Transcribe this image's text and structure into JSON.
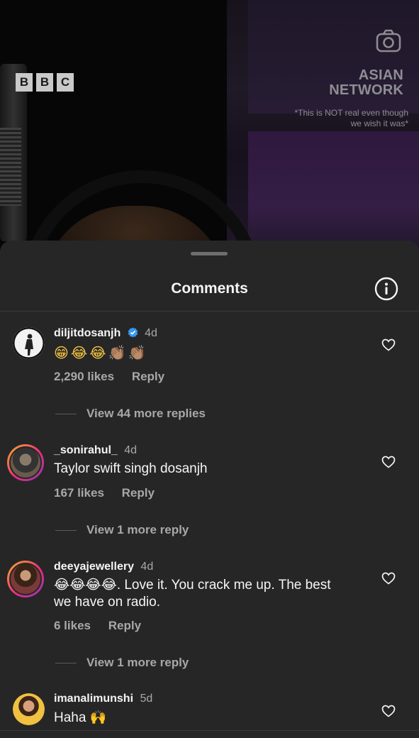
{
  "video": {
    "bbc_letters": [
      "B",
      "B",
      "C"
    ],
    "network_title_line1": "ASIAN",
    "network_title_line2": "NETWORK",
    "network_note": "*This is NOT real even though we wish it was*"
  },
  "sheet": {
    "title": "Comments"
  },
  "comments": [
    {
      "username": "diljitdosanjh",
      "verified": true,
      "time": "4d",
      "text": "😁😂😂👏🏽👏🏽",
      "likes": "2,290 likes",
      "reply_label": "Reply",
      "view_replies": "View 44 more replies"
    },
    {
      "username": "_sonirahul_",
      "time": "4d",
      "text": "Taylor swift singh dosanjh",
      "likes": "167 likes",
      "reply_label": "Reply",
      "view_replies": "View 1 more reply"
    },
    {
      "username": "deeyajewellery",
      "time": "4d",
      "text": "😂😂😂😂. Love it. You crack me up. The best we have on radio.",
      "likes": "6 likes",
      "reply_label": "Reply",
      "view_replies": "View 1 more reply"
    },
    {
      "username": "imanalimunshi",
      "time": "5d",
      "text": "Haha 🙌"
    }
  ],
  "colors": {
    "sheet_bg": "#262626",
    "text_primary": "#f5f5f5",
    "text_secondary": "#a8a8a8",
    "verified_blue": "#3897f0"
  }
}
